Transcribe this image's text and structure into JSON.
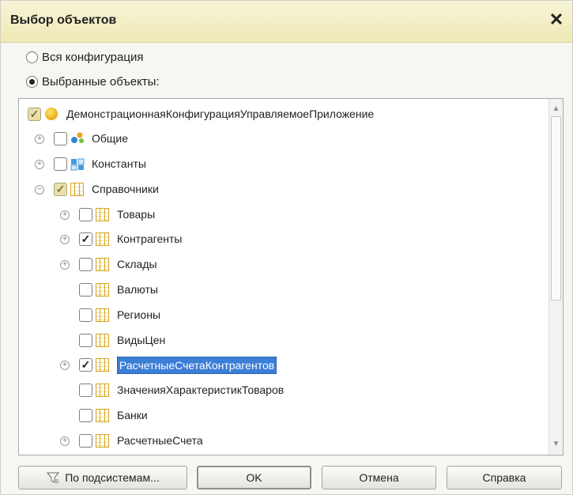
{
  "window": {
    "title": "Выбор объектов",
    "close": "✕"
  },
  "options": {
    "all_config": "Вся конфигурация",
    "selected_objects": "Выбранные объекты:"
  },
  "tree": {
    "items": [
      {
        "label": "ДемонстрационнаяКонфигурацияУправляемоеПриложение",
        "level": 0,
        "checked": "partial",
        "icon": "globe-icon",
        "expander": ""
      },
      {
        "label": "Общие",
        "level": 1,
        "checked": "unchecked",
        "icon": "common-icon",
        "expander": "⊕"
      },
      {
        "label": "Константы",
        "level": 1,
        "checked": "unchecked",
        "icon": "constant-icon",
        "expander": "⊕"
      },
      {
        "label": "Справочники",
        "level": 1,
        "checked": "partial",
        "icon": "catalog-icon",
        "expander": "⊖"
      },
      {
        "label": "Товары",
        "level": 2,
        "checked": "unchecked",
        "icon": "catalog-icon",
        "expander": "⊕"
      },
      {
        "label": "Контрагенты",
        "level": 2,
        "checked": "checked",
        "icon": "catalog-icon",
        "expander": "⊕"
      },
      {
        "label": "Склады",
        "level": 2,
        "checked": "unchecked",
        "icon": "catalog-icon",
        "expander": "⊕"
      },
      {
        "label": "Валюты",
        "level": 2,
        "checked": "unchecked",
        "icon": "catalog-icon",
        "expander": ""
      },
      {
        "label": "Регионы",
        "level": 2,
        "checked": "unchecked",
        "icon": "catalog-icon",
        "expander": ""
      },
      {
        "label": "ВидыЦен",
        "level": 2,
        "checked": "unchecked",
        "icon": "catalog-icon",
        "expander": ""
      },
      {
        "label": "РасчетныеСчетаКонтрагентов",
        "level": 2,
        "checked": "checked",
        "icon": "catalog-icon",
        "expander": "⊕",
        "selected": true
      },
      {
        "label": "ЗначенияХарактеристикТоваров",
        "level": 2,
        "checked": "unchecked",
        "icon": "catalog-icon",
        "expander": ""
      },
      {
        "label": "Банки",
        "level": 2,
        "checked": "unchecked",
        "icon": "catalog-icon",
        "expander": ""
      },
      {
        "label": "РасчетныеСчета",
        "level": 2,
        "checked": "unchecked",
        "icon": "catalog-icon",
        "expander": "⊕"
      }
    ]
  },
  "buttons": {
    "subsystems": "По подсистемам...",
    "ok": "OK",
    "cancel": "Отмена",
    "help": "Справка"
  },
  "colors": {
    "title_bg": "#efe9b4",
    "selection": "#3b7ed6",
    "catalog_icon": "#d6a41e"
  }
}
